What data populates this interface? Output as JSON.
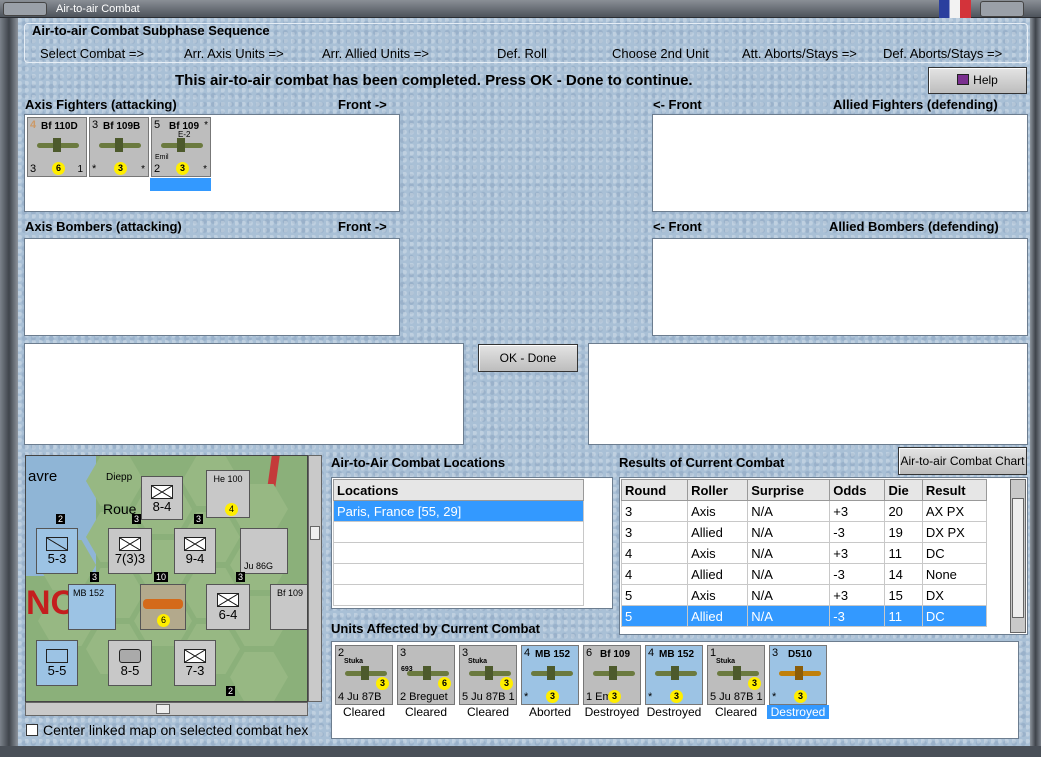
{
  "window": {
    "title": "Air-to-air Combat"
  },
  "sequence": {
    "title": "Air-to-air Combat Subphase Sequence",
    "steps": [
      "Select Combat =>",
      "Arr. Axis Units =>",
      "Arr. Allied Units =>",
      "Def. Roll",
      "Choose 2nd Unit",
      "Att. Aborts/Stays =>",
      "Def. Aborts/Stays =>"
    ]
  },
  "message": "This air-to-air combat has been completed.  Press OK - Done to continue.",
  "help_label": "Help",
  "sections": {
    "axis_fighters": "Axis Fighters (attacking)",
    "front_right": "Front ->",
    "front_left": "<- Front",
    "allied_fighters": "Allied Fighters (defending)",
    "axis_bombers": "Axis Bombers (attacking)",
    "allied_bombers": "Allied Bombers (defending)"
  },
  "axis_fighter_units": [
    {
      "top": "4",
      "name": "Bf 110D",
      "left_val": "3",
      "die": "6",
      "right_val": "1",
      "color": "grey"
    },
    {
      "top": "3",
      "name": "Bf 109B",
      "left_val": "*",
      "die": "3",
      "right_val": "*",
      "color": "grey"
    },
    {
      "top": "5",
      "name": "Bf 109",
      "sub": "E-2",
      "note": "Emil",
      "left_val": "2",
      "die": "3",
      "right_val": "*",
      "color": "blue"
    }
  ],
  "ok_label": "OK - Done",
  "locations": {
    "title": "Air-to-Air Combat Locations",
    "header": "Locations",
    "rows": [
      "Paris, France [55, 29]",
      "",
      "",
      "",
      ""
    ]
  },
  "results": {
    "title": "Results of Current Combat",
    "chart_button": "Air-to-air Combat Chart",
    "headers": [
      "Round",
      "Roller",
      "Surprise",
      "Odds",
      "Die",
      "Result"
    ],
    "rows": [
      [
        "3",
        "Axis",
        "N/A",
        "+3",
        "20",
        "AX PX"
      ],
      [
        "3",
        "Allied",
        "N/A",
        "-3",
        "19",
        "DX PX"
      ],
      [
        "4",
        "Axis",
        "N/A",
        "+3",
        "11",
        "DC"
      ],
      [
        "4",
        "Allied",
        "N/A",
        "-3",
        "14",
        "None"
      ],
      [
        "5",
        "Axis",
        "N/A",
        "+3",
        "15",
        "DX"
      ],
      [
        "5",
        "Allied",
        "N/A",
        "-3",
        "11",
        "DC"
      ]
    ],
    "selected_row": 5
  },
  "affected": {
    "title": "Units Affected by Current Combat",
    "units": [
      {
        "top": "2",
        "name": "Stuka",
        "bottom": "4  Ju 87B",
        "die": "3",
        "status": "Cleared",
        "color": "grey"
      },
      {
        "top": "3",
        "name": "693",
        "bottom": "2  Breguet",
        "die": "6",
        "status": "Cleared",
        "color": "grey"
      },
      {
        "top": "3",
        "name": "Stuka",
        "bottom": "5  Ju 87B  1",
        "die": "3",
        "status": "Cleared",
        "color": "grey"
      },
      {
        "top": "4",
        "name": "MB 152",
        "bottom": "*",
        "die": "3",
        "status": "Aborted",
        "color": "blue"
      },
      {
        "top": "6",
        "name": "Bf 109",
        "bottom": "1  Emil",
        "die": "3",
        "status": "Destroyed",
        "color": "grey"
      },
      {
        "top": "4",
        "name": "MB 152",
        "bottom": "*",
        "die": "3",
        "status": "Destroyed",
        "color": "blue"
      },
      {
        "top": "1",
        "name": "Stuka",
        "bottom": "5  Ju 87B  1",
        "die": "3",
        "status": "Cleared",
        "color": "grey"
      },
      {
        "top": "3",
        "name": "D510",
        "bottom": "*",
        "die": "3",
        "status": "Destroyed",
        "color": "blue"
      }
    ],
    "selected_index": 7
  },
  "map": {
    "labels": [
      "avre",
      "Diepp",
      "Roue",
      "NO"
    ],
    "counters": [
      {
        "text": "8-4",
        "type": "grey"
      },
      {
        "text": "He 100",
        "type": "grey"
      },
      {
        "text": "5-3",
        "type": "blue"
      },
      {
        "text": "7(3)3",
        "type": "grey"
      },
      {
        "text": "9-4",
        "type": "grey"
      },
      {
        "text": "Ju 86G",
        "type": "grey"
      },
      {
        "text": "MB 152",
        "type": "blue"
      },
      {
        "text": "6-4",
        "type": "grey"
      },
      {
        "text": "Bf 109",
        "type": "grey"
      },
      {
        "text": "5-5",
        "type": "blue"
      },
      {
        "text": "8-5",
        "type": "grey"
      },
      {
        "text": "7-3",
        "type": "grey"
      }
    ],
    "small_nums": [
      "2",
      "3",
      "3",
      "10",
      "3",
      "3",
      "2"
    ]
  },
  "center_checkbox": "Center linked map on selected combat hex"
}
